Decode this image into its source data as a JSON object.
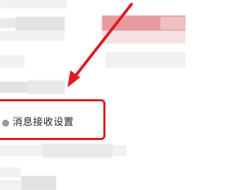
{
  "settings": {
    "message_receive_settings": {
      "label": "消息接收设置",
      "icon": "settings-dot-icon"
    }
  },
  "annotation": {
    "color": "#e0191f"
  }
}
